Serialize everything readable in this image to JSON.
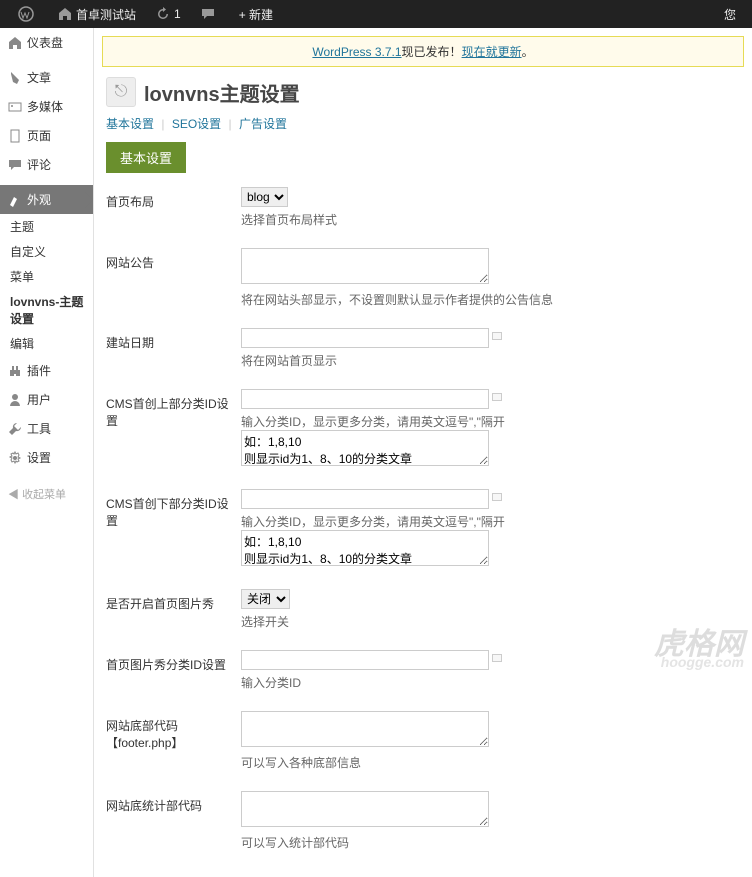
{
  "adminbar": {
    "site": "首卓测试站",
    "refresh": "1",
    "new": "+ 新建",
    "greeting": "您"
  },
  "sidebar": {
    "items": [
      {
        "name": "dashboard",
        "icon": "home",
        "label": "仪表盘"
      },
      {
        "name": "posts",
        "icon": "pin",
        "label": "文章"
      },
      {
        "name": "media",
        "icon": "media",
        "label": "多媒体"
      },
      {
        "name": "pages",
        "icon": "page",
        "label": "页面"
      },
      {
        "name": "comments",
        "icon": "comment",
        "label": "评论"
      }
    ],
    "appearance": {
      "label": "外观",
      "icon": "brush"
    },
    "subs": [
      {
        "label": "主题"
      },
      {
        "label": "自定义"
      },
      {
        "label": "菜单"
      },
      {
        "label": "lovnvns-主题设置"
      },
      {
        "label": "编辑"
      }
    ],
    "items2": [
      {
        "name": "plugins",
        "icon": "plug",
        "label": "插件"
      },
      {
        "name": "users",
        "icon": "user",
        "label": "用户"
      },
      {
        "name": "tools",
        "icon": "tool",
        "label": "工具"
      },
      {
        "name": "settings",
        "icon": "gear",
        "label": "设置"
      }
    ],
    "collapse": "收起菜单"
  },
  "notice": {
    "prefix": "WordPress 3.7.1",
    "mid": "现已发布！",
    "link": "现在就更新"
  },
  "page": {
    "title": "lovnvns主题设置"
  },
  "tabs": {
    "basic": "基本设置",
    "seo": "SEO设置",
    "ad": "广告设置"
  },
  "section": "基本设置",
  "fields": {
    "layout": {
      "label": "首页布局",
      "val": "blog",
      "help": "选择首页布局样式"
    },
    "announce": {
      "label": "网站公告",
      "help": "将在网站头部显示，不设置则默认显示作者提供的公告信息"
    },
    "build_date": {
      "label": "建站日期",
      "help": "将在网站首页显示"
    },
    "cms_top": {
      "label": "CMS首创上部分类ID设置",
      "tip": "输入分类ID，显示更多分类，请用英文逗号\",\"隔开",
      "val": "如：1,8,10\n则显示id为1、8、10的分类文章"
    },
    "cms_bottom": {
      "label": "CMS首创下部分类ID设置",
      "tip": "输入分类ID，显示更多分类，请用英文逗号\",\"隔开",
      "val": "如：1,8,10\n则显示id为1、8、10的分类文章"
    },
    "slideshow": {
      "label": "是否开启首页图片秀",
      "val": "关闭",
      "help": "选择开关"
    },
    "slide_cat": {
      "label": "首页图片秀分类ID设置",
      "help": "输入分类ID"
    },
    "footer": {
      "label": "网站底部代码【footer.php】",
      "help": "可以写入各种底部信息"
    },
    "stats": {
      "label": "网站底统计部代码",
      "help": "可以写入统计部代码"
    }
  },
  "watermark": {
    "main": "虎格网",
    "sub": "hoogge.com"
  }
}
